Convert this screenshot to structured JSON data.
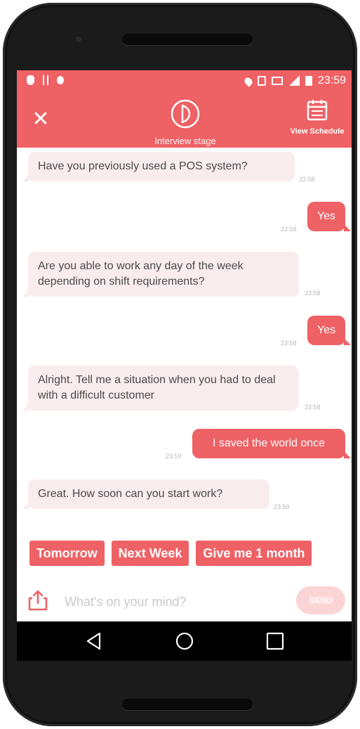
{
  "status_bar": {
    "time": "23:59",
    "icons_left": [
      "shield-icon",
      "usb-icon",
      "bug-icon"
    ],
    "icons_right": [
      "location-icon",
      "vibrate-icon",
      "network-icon",
      "signal-icon",
      "battery-icon"
    ]
  },
  "app_bar": {
    "close_icon": "close-icon",
    "stage_label": "Interview stage",
    "schedule_label": "View Schedule"
  },
  "messages": [
    {
      "from": "bot",
      "text": "Have you previously used a POS system?",
      "time": "23:58"
    },
    {
      "from": "user",
      "text": "Yes",
      "time": "23:58"
    },
    {
      "from": "bot",
      "text": "Are you able to work any day of the week depending on shift requirements?",
      "time": "23:58"
    },
    {
      "from": "user",
      "text": "Yes",
      "time": "23:58"
    },
    {
      "from": "bot",
      "text": "Alright. Tell me a situation when you had to deal with a difficult customer",
      "time": "23:58"
    },
    {
      "from": "user",
      "text": "I saved the world once",
      "time": "23:59"
    },
    {
      "from": "bot",
      "text": "Great. How soon can you start work?",
      "time": "23:59"
    }
  ],
  "quick_replies": [
    "Tomorrow",
    "Next Week",
    "Give me 1 month"
  ],
  "composer": {
    "placeholder": "What's on your mind?",
    "send_label": "SEND"
  },
  "colors": {
    "accent": "#ee6165",
    "bubble_in": "#f9ecec",
    "send_disabled": "#fbd5d6"
  }
}
